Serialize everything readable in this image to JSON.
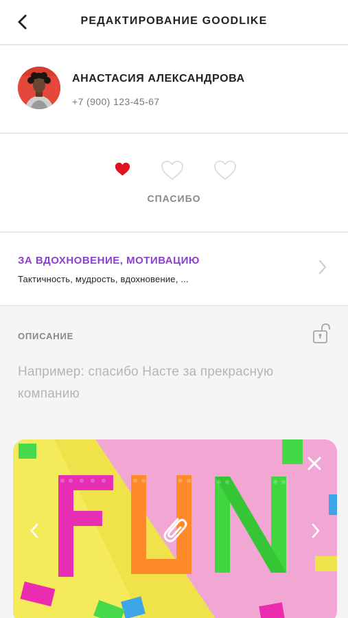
{
  "header": {
    "title": "РЕДАКТИРОВАНИЕ GOODLIKE",
    "back_icon": "chevron-left-icon"
  },
  "user": {
    "name": "АНАСТАСИЯ АЛЕКСАНДРОВА",
    "phone": "+7 (900) 123-45-67"
  },
  "rating": {
    "level": 1,
    "max": 3,
    "label": "СПАСИБО",
    "active_color": "#e0141e",
    "inactive_color": "#dcdcdc"
  },
  "category": {
    "title": "ЗА ВДОХНОВЕНИЕ, МОТИВАЦИЮ",
    "subtitle": "Тактичность, мудрость, вдохновение, ...",
    "accent_color": "#8b3fd1"
  },
  "description": {
    "label": "ОПИСАНИЕ",
    "placeholder": "Например: спасибо Насте за прекрасную компанию",
    "image_text": "FUN"
  }
}
